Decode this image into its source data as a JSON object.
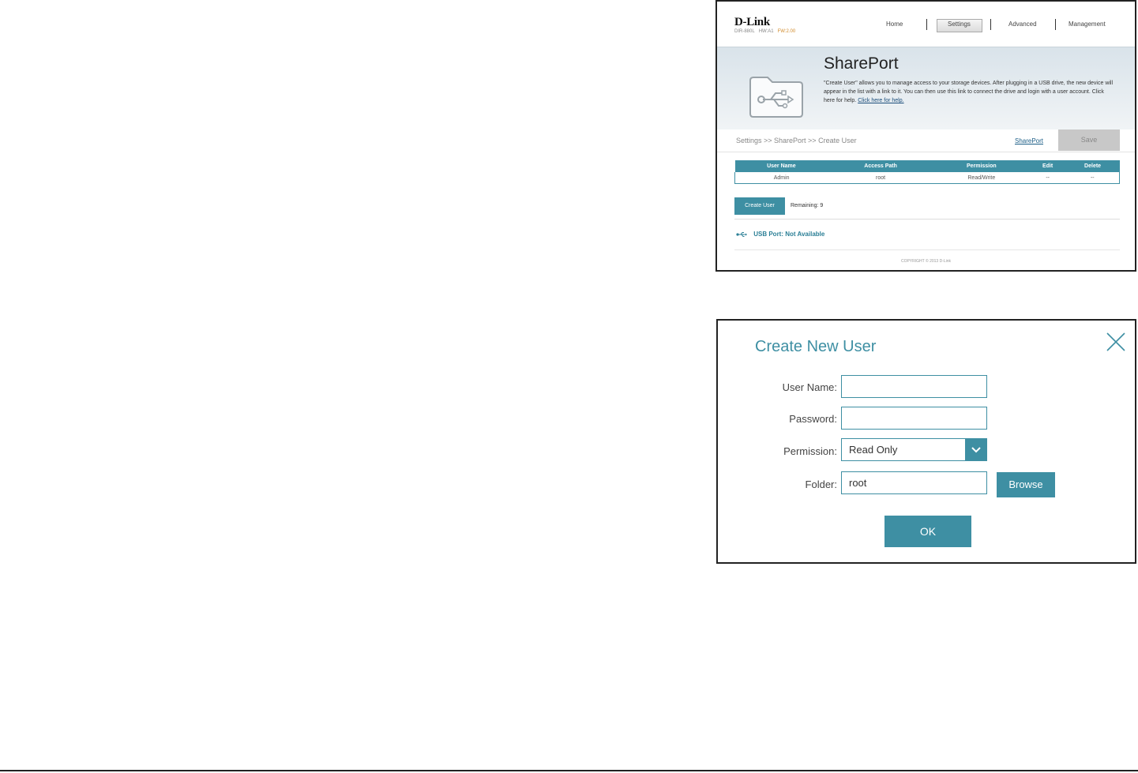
{
  "shareport_page": {
    "logo": "D-Link",
    "model": "DIR-880L",
    "hw": "HW:A1",
    "fw": "FW:2.00",
    "nav": [
      "Home",
      "Settings",
      "Advanced",
      "Management"
    ],
    "active_nav": "Settings",
    "title": "SharePort",
    "description": "\"Create User\" allows you to manage access to your storage devices. After plugging in a USB drive, the new device will appear in the list with a link to it. You can then use this link to connect the drive and login with a user account. Click here for help.",
    "help_link": "Click here for help.",
    "breadcrumb": "Settings >> SharePort >> Create User",
    "shareport_link": "SharePort",
    "save_label": "Save",
    "table": {
      "headers": [
        "User Name",
        "Access Path",
        "Permission",
        "Edit",
        "Delete"
      ],
      "rows": [
        [
          "Admin",
          "root",
          "Read/Write",
          "--",
          "--"
        ]
      ]
    },
    "create_user_label": "Create User",
    "remaining": "Remaining: 9",
    "usb_label": "USB Port:",
    "usb_status": "Not Available",
    "copyright": "COPYRIGHT © 2013 D-Link",
    "accent_color": "#3e8fa3"
  },
  "dialog": {
    "title": "Create New User",
    "fields": {
      "user_name_label": "User Name:",
      "user_name_value": "",
      "password_label": "Password:",
      "password_value": "",
      "permission_label": "Permission:",
      "permission_value": "Read Only",
      "folder_label": "Folder:",
      "folder_value": "root"
    },
    "browse_label": "Browse",
    "ok_label": "OK",
    "close_icon": "close-icon"
  }
}
